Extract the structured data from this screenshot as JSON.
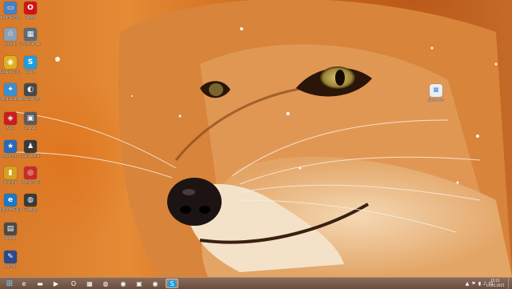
{
  "desktop": {
    "icons": [
      {
        "label": "Компьютер",
        "icon": "computer-icon",
        "color": "#4a7fc1",
        "glyph": "▭"
      },
      {
        "label": "Opera",
        "icon": "opera-icon",
        "color": "#d1141b",
        "glyph": "O"
      },
      {
        "label": "Корзина",
        "icon": "recycle-bin-icon",
        "color": "#8aa0b8",
        "glyph": "♲"
      },
      {
        "label": "Поле битвы",
        "icon": "game-icon",
        "color": "#5a6b7a",
        "glyph": "▦"
      },
      {
        "label": "Google Chrome",
        "icon": "chrome-icon",
        "color": "#e0b020",
        "glyph": "◉"
      },
      {
        "label": "Skype",
        "icon": "skype-icon",
        "color": "#1a9fe0",
        "glyph": "S"
      },
      {
        "label": "Panda Cloud",
        "icon": "panda-icon",
        "color": "#3a8fd0",
        "glyph": "✦"
      },
      {
        "label": "Mozilla Firefox",
        "icon": "firefox-icon",
        "color": "#4a4a4a",
        "glyph": "◐"
      },
      {
        "label": "Avira",
        "icon": "avira-icon",
        "color": "#c81e1e",
        "glyph": "◈"
      },
      {
        "label": "Сервис",
        "icon": "service-icon",
        "color": "#5c5c5c",
        "glyph": "▣"
      },
      {
        "label": "Ассистент",
        "icon": "assistant-icon",
        "color": "#2a6ab8",
        "glyph": "★"
      },
      {
        "label": "Приложения",
        "icon": "apps-icon",
        "color": "#3a3a3a",
        "glyph": "♟"
      },
      {
        "label": "Winamp",
        "icon": "winamp-icon",
        "color": "#d8a020",
        "glyph": "▮"
      },
      {
        "label": "Daemon Tools",
        "icon": "daemon-icon",
        "color": "#c82a2a",
        "glyph": "◎"
      },
      {
        "label": "Internet Explorer",
        "icon": "ie-icon",
        "color": "#1c78c8",
        "glyph": "e"
      },
      {
        "label": "CCleaner",
        "icon": "ccleaner-icon",
        "color": "#3a3a3a",
        "glyph": "◍"
      },
      {
        "label": "Видео",
        "icon": "video-icon",
        "color": "#4a4a4a",
        "glyph": "▤"
      },
      {
        "label": "Мастер",
        "icon": "wizard-icon",
        "color": "#2a4a8a",
        "glyph": "✎"
      },
      {
        "label": "Документ",
        "icon": "document-icon",
        "color": "#e8eef6",
        "glyph": "≡"
      }
    ]
  },
  "taskbar": {
    "items": [
      {
        "name": "start",
        "icon": "windows-start-icon",
        "glyph": "⊞"
      },
      {
        "name": "ie",
        "icon": "ie-icon",
        "glyph": "e"
      },
      {
        "name": "explorer",
        "icon": "folder-icon",
        "glyph": "▬"
      },
      {
        "name": "media",
        "icon": "media-player-icon",
        "glyph": "▶"
      },
      {
        "name": "opera",
        "icon": "opera-icon",
        "glyph": "O"
      },
      {
        "name": "app1",
        "icon": "app-icon",
        "glyph": "▦"
      },
      {
        "name": "ccleaner",
        "icon": "ccleaner-icon",
        "glyph": "◍"
      },
      {
        "name": "app2",
        "icon": "app-icon",
        "glyph": "◉"
      },
      {
        "name": "app3",
        "icon": "app-icon",
        "glyph": "▣"
      },
      {
        "name": "chrome",
        "icon": "chrome-icon",
        "glyph": "◉"
      },
      {
        "name": "app4",
        "icon": "app-icon",
        "glyph": "▥"
      },
      {
        "name": "skype",
        "icon": "skype-icon",
        "glyph": "S"
      }
    ],
    "tray": [
      "▲",
      "⚑",
      "▮",
      "♪",
      "⊡"
    ],
    "clock": {
      "time": "15:21",
      "date": "13.05.2015"
    }
  }
}
